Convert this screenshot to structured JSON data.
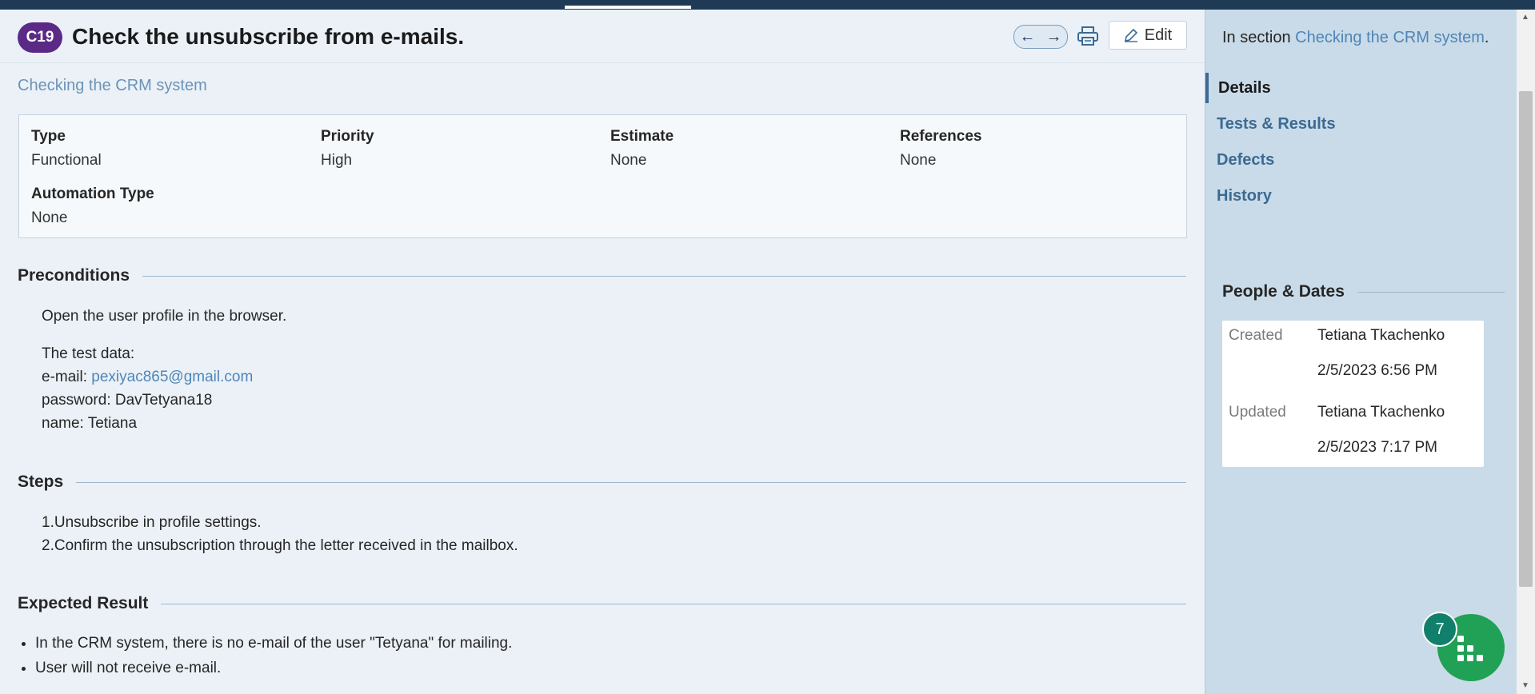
{
  "case": {
    "id": "C19",
    "title": "Check the unsubscribe from e-mails.",
    "section_link": "Checking the CRM system"
  },
  "toolbar": {
    "prev_glyph": "←",
    "next_glyph": "→",
    "edit_label": "Edit"
  },
  "properties": {
    "type_label": "Type",
    "type_value": "Functional",
    "priority_label": "Priority",
    "priority_value": "High",
    "estimate_label": "Estimate",
    "estimate_value": "None",
    "references_label": "References",
    "references_value": "None",
    "automation_label": "Automation Type",
    "automation_value": "None"
  },
  "preconditions": {
    "heading": "Preconditions",
    "line1": "Open the user profile in the browser.",
    "line2": "The test data:",
    "email_prefix": "e-mail: ",
    "email": "pexiyac865@gmail.com",
    "password_line": "password: DavTetyana18",
    "name_line": "name: Tetiana"
  },
  "steps": {
    "heading": "Steps",
    "items": [
      "1.Unsubscribe in profile settings.",
      "2.Confirm the unsubscription through the letter received in the mailbox."
    ]
  },
  "expected": {
    "heading": "Expected Result",
    "items": [
      "In the CRM system, there is no e-mail of the user \"Tetyana\" for mailing.",
      "User will not receive e-mail."
    ]
  },
  "sidebar": {
    "in_section_prefix": "In section ",
    "in_section_link": "Checking the CRM system",
    "in_section_suffix": ".",
    "nav": [
      "Details",
      "Tests & Results",
      "Defects",
      "History"
    ],
    "people_heading": "People & Dates",
    "created_label": "Created",
    "created_by": "Tetiana Tkachenko",
    "created_at": "2/5/2023 6:56 PM",
    "updated_label": "Updated",
    "updated_by": "Tetiana Tkachenko",
    "updated_at": "2/5/2023 7:17 PM"
  },
  "fab": {
    "badge_count": "7"
  },
  "colors": {
    "badge": "#5b2a86",
    "link": "#4f85b8",
    "fab": "#21a155",
    "sidebar": "#c9dbe8"
  }
}
